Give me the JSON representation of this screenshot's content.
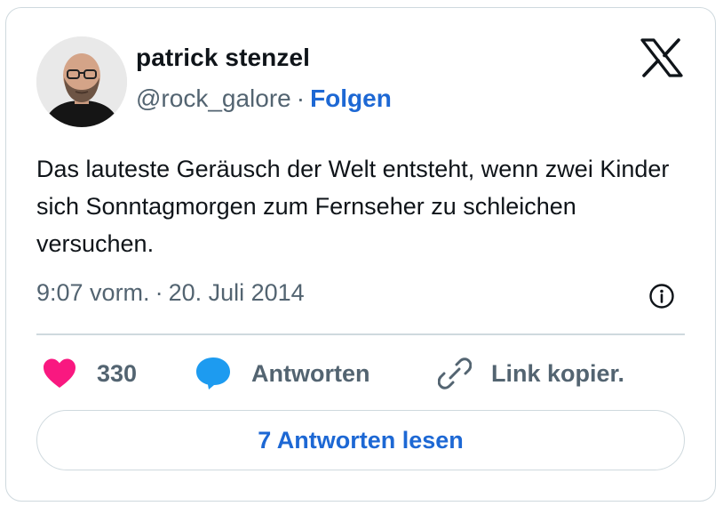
{
  "author": {
    "name": "patrick stenzel",
    "handle": "@rock_galore",
    "separator": "·",
    "follow_label": "Folgen"
  },
  "tweet": {
    "text": "Das lauteste Geräusch der Welt entsteht, wenn zwei Kinder sich Sonntagmorgen zum Fernseher zu schleichen versuchen.",
    "time": "9:07 vorm.",
    "meta_separator": "·",
    "date": "20. Juli 2014"
  },
  "actions": {
    "like_count": "330",
    "reply_label": "Antworten",
    "copy_label": "Link kopier."
  },
  "read_replies_label": "7 Antworten lesen",
  "icons": {
    "brand": "x-logo-icon",
    "info": "info-icon",
    "like": "heart-icon",
    "reply": "speech-bubble-icon",
    "copy": "link-icon"
  },
  "colors": {
    "accent": "#1d68d4",
    "like": "#f91880",
    "reply": "#1d9bf0",
    "secondary_text": "#536471",
    "border": "#cfd9de"
  }
}
